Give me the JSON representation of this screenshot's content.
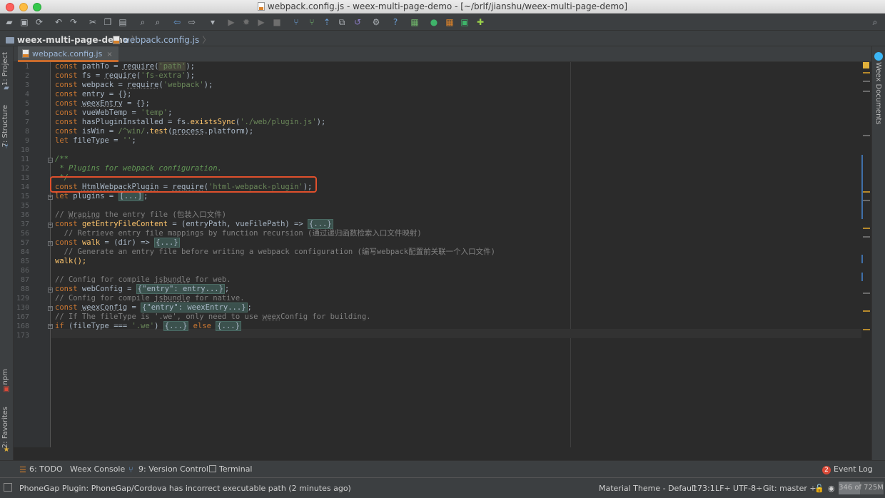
{
  "window": {
    "title": "webpack.config.js - weex-multi-page-demo - [~/brlf/jianshu/weex-multi-page-demo]"
  },
  "toolbar": {
    "icons": [
      "open-folder-icon",
      "save-icon",
      "sync-icon",
      "undo-icon",
      "redo-icon",
      "cut-icon",
      "copy-icon",
      "paste-icon",
      "find-icon",
      "replace-icon",
      "back-icon",
      "forward-icon",
      "run-config-dropdown-icon",
      "run-icon",
      "debug-icon",
      "coverage-icon",
      "stop-icon",
      "vcs-update-icon",
      "vcs-commit-icon",
      "vcs-push-icon",
      "vcs-compare-icon",
      "vcs-revert-icon",
      "settings-icon",
      "help-icon",
      "structure-icon",
      "weex-preview-icon",
      "weex-palette-icon",
      "weex-device-icon",
      "plugin-icon"
    ]
  },
  "breadcrumb": {
    "project": "weex-multi-page-demo",
    "file": "webpack.config.js"
  },
  "left_tabs": {
    "project": "1: Project",
    "structure": "7: Structure",
    "npm": "npm",
    "favorites": "2: Favorites"
  },
  "right_tabs": {
    "weex_docs": "Weex Documents"
  },
  "editor": {
    "tab_label": "webpack.config.js",
    "tab_close": "×",
    "line_numbers": [
      "1",
      "2",
      "3",
      "4",
      "5",
      "6",
      "7",
      "8",
      "9",
      "10",
      "11",
      "12",
      "13",
      "14",
      "15",
      "35",
      "36",
      "37",
      "56",
      "57",
      "84",
      "85",
      "86",
      "87",
      "88",
      "129",
      "130",
      "167",
      "168",
      "173"
    ],
    "lines": {
      "l1": {
        "kw": "const",
        "a": " pathTo = ",
        "req": "require",
        "b": "(",
        "s": "'path'",
        "c": ");"
      },
      "l2": {
        "kw": "const",
        "a": " fs = ",
        "req": "require",
        "b": "(",
        "s": "'fs-extra'",
        "c": ");"
      },
      "l3": {
        "kw": "const",
        "a": " webpack = ",
        "req": "require",
        "b": "(",
        "s": "'webpack'",
        "c": ");"
      },
      "l4": {
        "kw": "const",
        "a": " entry = {};"
      },
      "l5": {
        "kw": "const",
        "a": " ",
        "u": "weexEntry",
        "b": " = {};"
      },
      "l6": {
        "kw": "const",
        "a": " vueWebTemp = ",
        "s": "'temp'",
        "c": ";"
      },
      "l7": {
        "kw": "const",
        "a": " hasPluginInstalled = fs.",
        "fn": "existsSync",
        "b": "(",
        "s": "'./web/plugin.js'",
        "c": ");"
      },
      "l8": {
        "kw": "const",
        "a": " isWin = ",
        "s": "/^win/",
        "b": ".",
        "fn": "test",
        "c": "(",
        "u": "process",
        "d": ".platform);"
      },
      "l9": {
        "kw": "let",
        "a": " fileType = ",
        "s": "''",
        "c": ";"
      },
      "l11": {
        "doc": "/**"
      },
      "l12": {
        "doc": " * Plugins for webpack configuration."
      },
      "l13": {
        "doc": " */"
      },
      "l14": {
        "kw": "const",
        "a": " ",
        "u": "HtmlWebpackPlugin",
        "b": " = ",
        "req": "require",
        "c": "(",
        "s": "'html-webpack-plugin'",
        "d": ");"
      },
      "l15": {
        "kw": "let",
        "a": " plugins = ",
        "f": "[...]",
        "b": ";"
      },
      "l36": {
        "cmt_a": "// ",
        "cmt_u": "Wraping",
        "cmt_b": " the entry file (包装入口文件)"
      },
      "l37": {
        "kw": "const",
        "a": " ",
        "fn": "getEntryFileContent",
        "b": " = (entryPath, vueFilePath) => ",
        "f": "{...}"
      },
      "l56": {
        "cmt": "  // Retrieve entry file mappings by function recursion (通过递归函数检索入口文件映射)"
      },
      "l57": {
        "kw": "const",
        "a": " ",
        "fn": "walk",
        "b": " = (dir) => ",
        "f": "{...}"
      },
      "l84": {
        "cmt": "  // Generate an entry file before writing a webpack configuration (编写webpack配置前关联一个入口文件)"
      },
      "l85": {
        "a": "walk();"
      },
      "l87": {
        "cmt_a": "// Config for compile ",
        "cmt_u": "jsbundle",
        "cmt_b": " for web."
      },
      "l88": {
        "kw": "const",
        "a": " webConfig = ",
        "f": "{\"entry\": entry...}",
        "b": ";"
      },
      "l129": {
        "cmt_a": "// Config for compile ",
        "cmt_u": "jsbundle",
        "cmt_b": " for native."
      },
      "l130": {
        "kw": "const",
        "a": " ",
        "u": "weexConfig",
        "b": " = ",
        "f": "{\"entry\": weexEntry...}",
        "c": ";"
      },
      "l167": {
        "cmt_a": "// If The fileType is '.we', only need to use ",
        "cmt_u": "weex",
        "cmt_b": "Config for building."
      },
      "l168": {
        "kw": "if",
        "a": " (fileType === ",
        "s": "'.we'",
        "b": ") ",
        "f": "{...}",
        "kw2": " else ",
        "f2": "{...}"
      }
    }
  },
  "tool_windows": {
    "todo": "6: TODO",
    "weex_console": "Weex Console",
    "version_control": "9: Version Control",
    "terminal": "Terminal",
    "event_log_count": "2",
    "event_log": "Event Log"
  },
  "status": {
    "message": "PhoneGap Plugin: PhoneGap/Cordova has incorrect executable path (2 minutes ago)",
    "theme": "Material Theme - Default",
    "position": "173:1",
    "line_sep": "LF÷",
    "encoding": "UTF-8÷",
    "git": "Git: master ÷",
    "memory": "346 of 725M",
    "memory_used_fraction": 0.48
  },
  "colors": {
    "accent": "#c86b2d",
    "highlight_box": "#e0502c"
  }
}
